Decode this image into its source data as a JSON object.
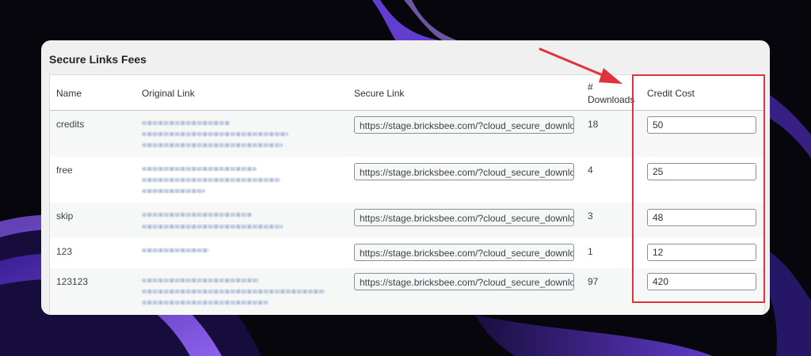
{
  "panel": {
    "title": "Secure Links Fees"
  },
  "table": {
    "columns": {
      "name": "Name",
      "original_link": "Original Link",
      "secure_link": "Secure Link",
      "downloads": [
        "#",
        "Downloads"
      ],
      "credit_cost": "Credit Cost"
    },
    "rows": [
      {
        "name": "credits",
        "secure_link": "https://stage.bricksbee.com/?cloud_secure_downlo",
        "downloads": "18",
        "credit_cost": "50"
      },
      {
        "name": "free",
        "secure_link": "https://stage.bricksbee.com/?cloud_secure_downlo",
        "downloads": "4",
        "credit_cost": "25"
      },
      {
        "name": "skip",
        "secure_link": "https://stage.bricksbee.com/?cloud_secure_downlo",
        "downloads": "3",
        "credit_cost": "48"
      },
      {
        "name": "123",
        "secure_link": "https://stage.bricksbee.com/?cloud_secure_downlo",
        "downloads": "1",
        "credit_cost": "12"
      },
      {
        "name": "123123",
        "secure_link": "https://stage.bricksbee.com/?cloud_secure_downlo",
        "downloads": "97",
        "credit_cost": "420"
      }
    ]
  },
  "annotation": {
    "highlight_color": "#e0323a",
    "arrow_color": "#e0323a"
  },
  "background": {
    "base": "#07060d",
    "accent": "#7b4dff"
  }
}
